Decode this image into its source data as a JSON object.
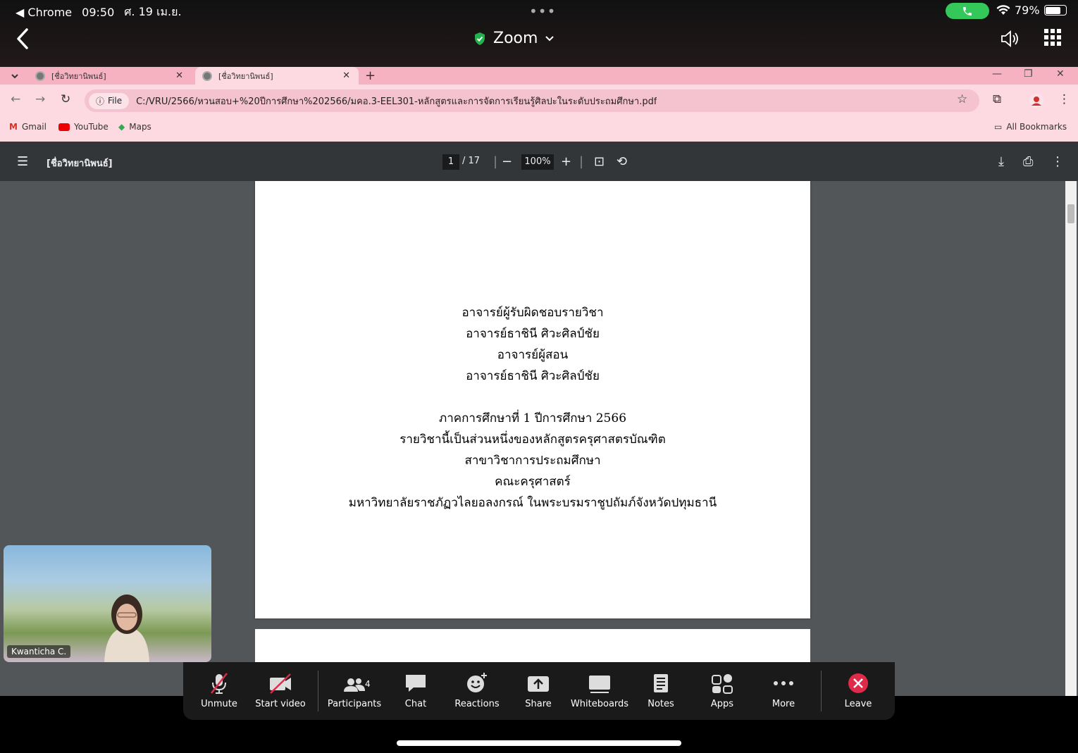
{
  "status_bar": {
    "back_app": "◀ Chrome",
    "time": "09:50",
    "date": "ศ. 19 เม.ย.",
    "battery": "79%"
  },
  "zoom_header": {
    "title": "Zoom"
  },
  "browser": {
    "tabs": [
      {
        "label": "[ชื่อวิทยานิพนธ์]"
      },
      {
        "label": "[ชื่อวิทยานิพนธ์]"
      }
    ],
    "file_chip": "File",
    "url": "C:/VRU/2566/หวนสอบ+%20ปีการศึกษา%202566/มคอ.3-EEL301-หลักสูตรและการจัดการเรียนรู้ศิลปะในระดับประถมศึกษา.pdf",
    "bookmarks": [
      {
        "label": "Gmail"
      },
      {
        "label": "YouTube"
      },
      {
        "label": "Maps"
      }
    ],
    "all_bookmarks": "All Bookmarks"
  },
  "pdf_viewer": {
    "title": "[ชื่อวิทยานิพนธ์]",
    "current_page": "1",
    "total_pages": "/ 17",
    "zoom": "100%"
  },
  "pdf_page": {
    "lines": [
      "อาจารย์ผู้รับผิดชอบรายวิชา",
      "อาจารย์ธาชินี ศิวะศิลป์ชัย",
      "อาจารย์ผู้สอน",
      "อาจารย์ธาชินี ศิวะศิลป์ชัย",
      "",
      "ภาคการศึกษาที่ 1 ปีการศึกษา 2566",
      "รายวิชานี้เป็นส่วนหนึ่งของหลักสูตรครุศาสตรบัณฑิต",
      "สาขาวิชาการประถมศึกษา",
      "คณะครุศาสตร์",
      "มหาวิทยาลัยราชภัฏวไลยอลงกรณ์ ในพระบรมราชูปถัมภ์จังหวัดปทุมธานี"
    ]
  },
  "video": {
    "name": "Kwanticha C."
  },
  "zoom_toolbar": {
    "unmute": "Unmute",
    "start_video": "Start video",
    "participants": "Participants",
    "participants_count": "4",
    "chat": "Chat",
    "reactions": "Reactions",
    "share": "Share",
    "whiteboards": "Whiteboards",
    "notes": "Notes",
    "apps": "Apps",
    "more": "More",
    "leave": "Leave"
  },
  "colors": {
    "browser_bg": "#fdd9e1",
    "tabstrip": "#f7b2c2",
    "pdf_toolbar": "#333639",
    "pdf_bg": "#525659",
    "leave_red": "#e02a4a",
    "call_green": "#34c759"
  }
}
